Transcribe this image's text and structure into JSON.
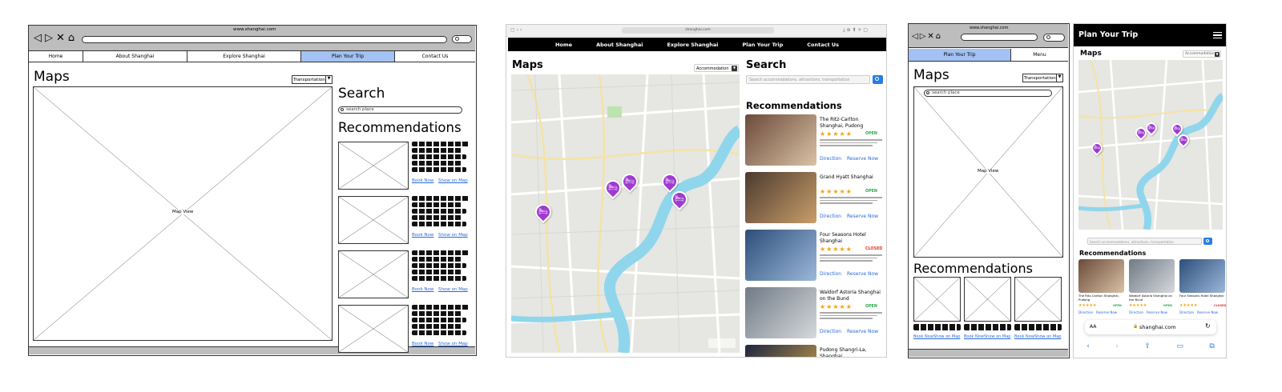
{
  "wireframe_desktop": {
    "url": "www.shanghai.com",
    "nav_symbols": [
      "◁",
      "▷",
      "✕",
      "⌂"
    ],
    "tabs": [
      "Home",
      "About Shanghai",
      "Explore Shanghai",
      "Plan Your Trip",
      "Contact Us"
    ],
    "active_tab": "Plan Your Trip",
    "maps_title": "Maps",
    "dropdown_value": "Transportation",
    "map_placeholder": "Map View",
    "search_title": "Search",
    "search_placeholder": "search place",
    "recommendations_title": "Recommendations",
    "book_now": "Book Now",
    "show_on_map": "Show on Map"
  },
  "mockup_desktop": {
    "url": "shanghai.com",
    "nav": [
      "Home",
      "About Shanghai",
      "Explore Shanghai",
      "Plan Your Trip",
      "Contact Us"
    ],
    "maps_title": "Maps",
    "dropdown_value": "Accommodation",
    "search_title": "Search",
    "search_placeholder": "Search accommodations, attractions, transportation",
    "recommendations_title": "Recommendations",
    "direction": "Direction",
    "reserve_now": "Reserve Now",
    "stars": "★★★★★",
    "hotels": [
      {
        "name": "The Ritz-Carlton Shanghai, Pudong",
        "status": "OPEN",
        "color": "#2aa84a"
      },
      {
        "name": "Grand Hyatt Shanghai",
        "status": "OPEN",
        "color": "#2aa84a"
      },
      {
        "name": "Four Seasons Hotel Shanghai",
        "status": "CLOSED",
        "color": "#e0352b"
      },
      {
        "name": "Waldorf Astoria Shanghai on the Bund",
        "status": "OPEN",
        "color": "#2aa84a"
      },
      {
        "name": "Pudong Shangri-La, Shanghai",
        "status": "",
        "color": "#2aa84a"
      }
    ]
  },
  "wireframe_mobile": {
    "url": "www.shanghai.com",
    "nav_symbols": [
      "◁",
      "▷",
      "✕",
      "⌂"
    ],
    "tabs": [
      "Plan Your Trip",
      "Menu"
    ],
    "maps_title": "Maps",
    "dropdown_value": "Transportation",
    "search_placeholder": "search place",
    "map_placeholder": "Map View",
    "recommendations_title": "Recommendations",
    "links": [
      "Book Now",
      "Show on Map"
    ]
  },
  "mockup_mobile": {
    "header_title": "Plan Your Trip",
    "maps_title": "Maps",
    "dropdown_value": "Accommodation",
    "search_placeholder": "Search accommodations, attractions, transportation",
    "recommendations_title": "Recommendations",
    "direction": "Direction",
    "reserve_now": "Reserve Now",
    "stars": "★★★★★",
    "cards": [
      {
        "name": "The Ritz-Carlton Shanghai, Pudong",
        "status": "OPEN",
        "color": "#2aa84a"
      },
      {
        "name": "Waldorf Astoria Shanghai on the Bund",
        "status": "OPEN",
        "color": "#2aa84a"
      },
      {
        "name": "Four Seasons Hotel Shanghai",
        "status": "CLOSED",
        "color": "#e0352b"
      }
    ],
    "address_bar": "shanghai.com",
    "aa": "AA"
  }
}
